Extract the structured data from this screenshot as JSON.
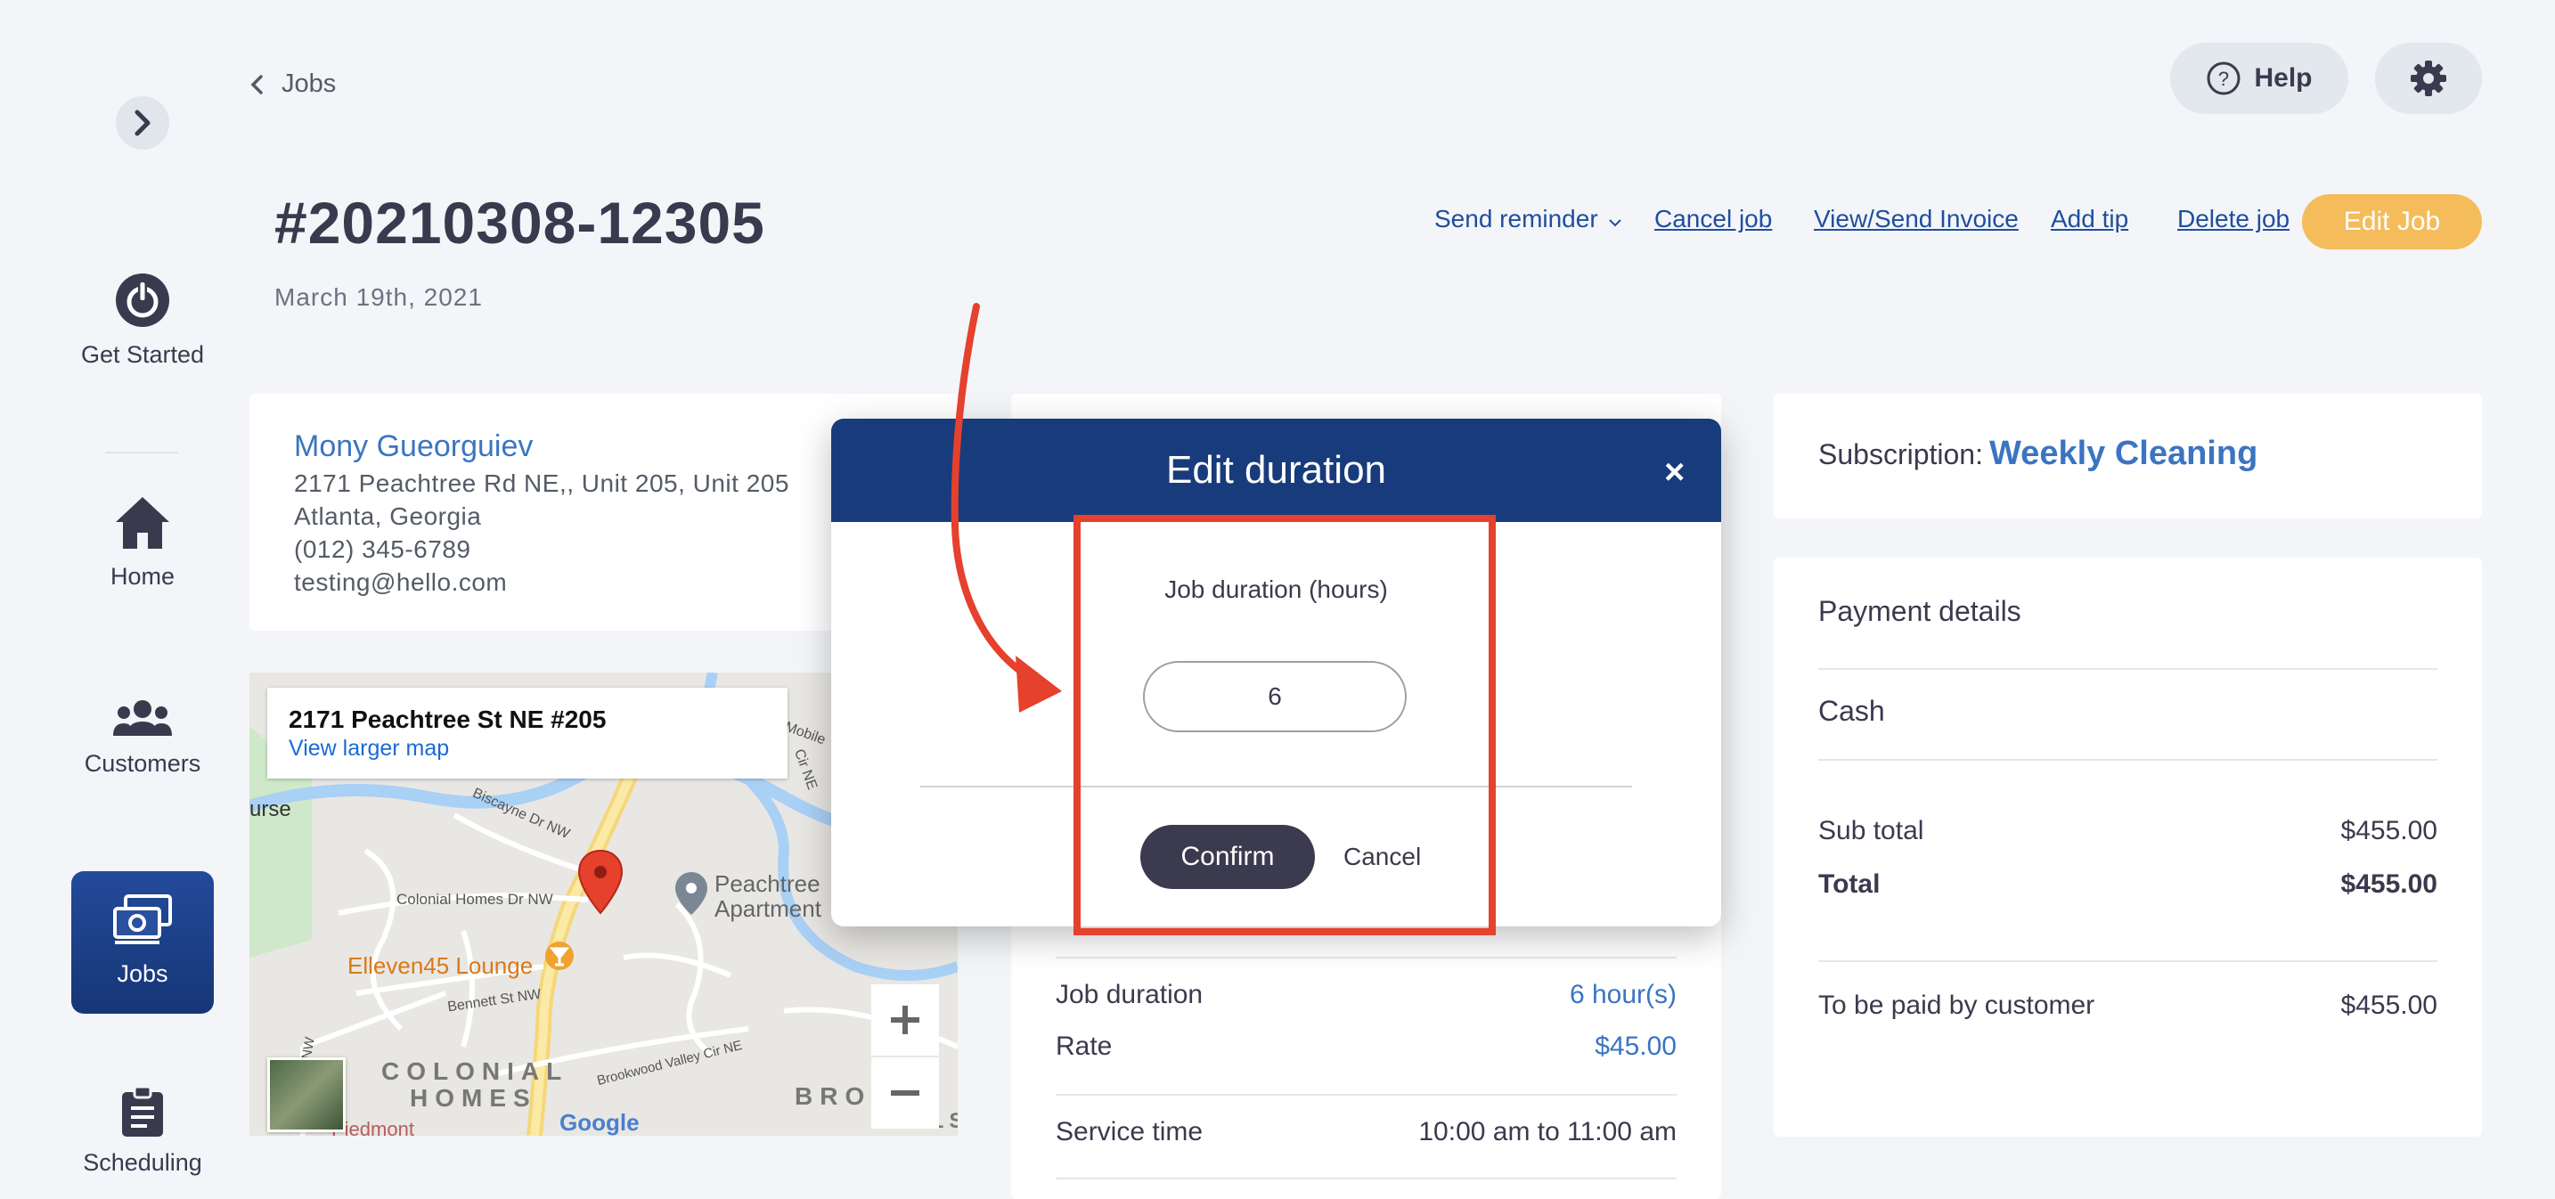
{
  "sidebar": {
    "toggle_icon": "chevron-right-icon",
    "items": [
      {
        "label": "Get Started",
        "icon": "power-icon"
      },
      {
        "label": "Home",
        "icon": "home-icon"
      },
      {
        "label": "Customers",
        "icon": "users-icon"
      },
      {
        "label": "Jobs",
        "icon": "jobs-icon",
        "active": true
      },
      {
        "label": "Scheduling",
        "icon": "clipboard-icon"
      }
    ]
  },
  "header": {
    "breadcrumb": "Jobs",
    "help_label": "Help",
    "job_number": "#20210308-12305",
    "job_date": "March 19th, 2021"
  },
  "actions": {
    "send_reminder": "Send reminder",
    "cancel_job": "Cancel job",
    "view_invoice": "View/Send Invoice",
    "add_tip": "Add tip",
    "delete_job": "Delete job",
    "edit_job": "Edit Job"
  },
  "customer": {
    "name": "Mony Gueorguiev",
    "address": "2171 Peachtree Rd NE,, Unit 205, Unit 205",
    "city": "Atlanta, Georgia",
    "phone": "(012) 345-6789",
    "email": "testing@hello.com"
  },
  "map": {
    "address": "2171 Peachtree St NE #205",
    "larger_link": "View larger map",
    "labels": {
      "urse": "urse",
      "biscayne": "Biscayne Dr NW",
      "colonial_dr": "Colonial Homes Dr NW",
      "elleven": "Elleven45 Lounge",
      "bennett": "Bennett St NW",
      "peachtree": "Peachtree",
      "apartment": "Apartment",
      "colonial": "COLONIAL",
      "homes": "HOMES",
      "brookwood": "Brookwood Valley Cir NE",
      "bro": "BRO",
      "hills": "HILLS",
      "google": "Google",
      "mobile": "Mobile",
      "cir_ne": "Cir NE",
      "view_dr": "view Dr NW",
      "piedmont": "Piedmont"
    }
  },
  "job_details": {
    "duration_label": "Job duration",
    "duration_value": "6 hour(s)",
    "rate_label": "Rate",
    "rate_value": "$45.00",
    "service_time_label": "Service time",
    "service_time_value": "10:00 am to 11:00 am"
  },
  "subscription": {
    "label": "Subscription:",
    "value": "Weekly Cleaning"
  },
  "payment": {
    "title": "Payment details",
    "method": "Cash",
    "subtotal_label": "Sub total",
    "subtotal_value": "$455.00",
    "total_label": "Total",
    "total_value": "$455.00",
    "paid_by_label": "To be paid by customer",
    "paid_by_value": "$455.00"
  },
  "modal": {
    "title": "Edit duration",
    "close": "×",
    "field_label": "Job duration (hours)",
    "field_value": "6",
    "confirm": "Confirm",
    "cancel": "Cancel"
  },
  "colors": {
    "accent": "#3b74c2",
    "modal_header": "#183b7c",
    "edit_button": "#f4bc5b",
    "annotation": "#e5412d",
    "nav_active": "#1f438c"
  }
}
